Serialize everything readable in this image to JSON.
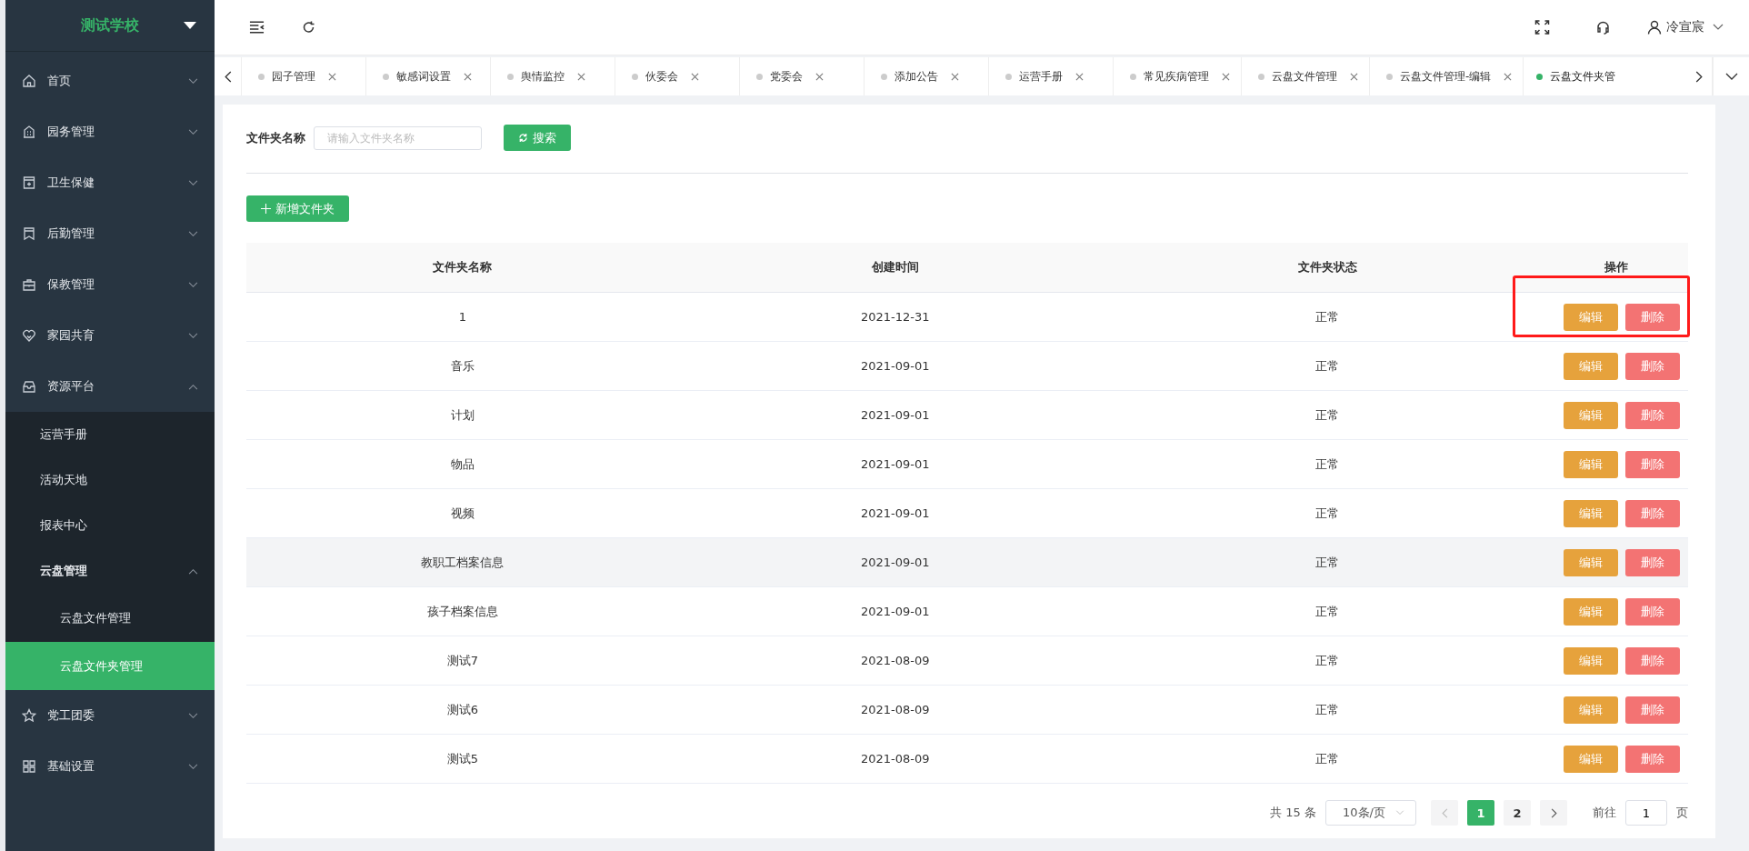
{
  "sidebar": {
    "school": "测试学校",
    "items": [
      {
        "label": "首页",
        "expanded": false
      },
      {
        "label": "园务管理",
        "expanded": false
      },
      {
        "label": "卫生保健",
        "expanded": false
      },
      {
        "label": "后勤管理",
        "expanded": false
      },
      {
        "label": "保教管理",
        "expanded": false
      },
      {
        "label": "家园共育",
        "expanded": false
      },
      {
        "label": "资源平台",
        "expanded": true,
        "children": [
          {
            "label": "运营手册",
            "selected": false
          },
          {
            "label": "活动天地",
            "selected": false
          },
          {
            "label": "报表中心",
            "selected": false
          },
          {
            "label": "云盘管理",
            "expanded": true,
            "children": [
              {
                "label": "云盘文件管理",
                "selected": false
              },
              {
                "label": "云盘文件夹管理",
                "selected": true
              }
            ]
          }
        ]
      },
      {
        "label": "党工团委",
        "expanded": false
      },
      {
        "label": "基础设置",
        "expanded": false
      }
    ]
  },
  "header": {
    "user": "冷宣宸"
  },
  "tabs": [
    {
      "label": "园子管理",
      "selected": false,
      "closable": true
    },
    {
      "label": "敏感词设置",
      "selected": false,
      "closable": true
    },
    {
      "label": "舆情监控",
      "selected": false,
      "closable": true
    },
    {
      "label": "伙委会",
      "selected": false,
      "closable": true
    },
    {
      "label": "党委会",
      "selected": false,
      "closable": true
    },
    {
      "label": "添加公告",
      "selected": false,
      "closable": true
    },
    {
      "label": "运营手册",
      "selected": false,
      "closable": true
    },
    {
      "label": "常见疾病管理",
      "selected": false,
      "closable": true
    },
    {
      "label": "云盘文件管理",
      "selected": false,
      "closable": true
    },
    {
      "label": "云盘文件管理-编辑",
      "selected": false,
      "closable": true
    },
    {
      "label": "云盘文件夹管",
      "selected": true,
      "closable": false
    }
  ],
  "search": {
    "label": "文件夹名称",
    "placeholder": "请输入文件夹名称",
    "button": "搜索"
  },
  "add_button": "新增文件夹",
  "table": {
    "columns": [
      "文件夹名称",
      "创建时间",
      "文件夹状态",
      "操作"
    ],
    "rows": [
      {
        "name": "1",
        "created": "2021-12-31",
        "status": "正常",
        "edit": "编辑",
        "delete": "删除",
        "highlighted": true,
        "hovered": false
      },
      {
        "name": "音乐",
        "created": "2021-09-01",
        "status": "正常",
        "edit": "编辑",
        "delete": "删除",
        "highlighted": false,
        "hovered": false
      },
      {
        "name": "计划",
        "created": "2021-09-01",
        "status": "正常",
        "edit": "编辑",
        "delete": "删除",
        "highlighted": false,
        "hovered": false
      },
      {
        "name": "物品",
        "created": "2021-09-01",
        "status": "正常",
        "edit": "编辑",
        "delete": "删除",
        "highlighted": false,
        "hovered": false
      },
      {
        "name": "视频",
        "created": "2021-09-01",
        "status": "正常",
        "edit": "编辑",
        "delete": "删除",
        "highlighted": false,
        "hovered": false
      },
      {
        "name": "教职工档案信息",
        "created": "2021-09-01",
        "status": "正常",
        "edit": "编辑",
        "delete": "删除",
        "highlighted": false,
        "hovered": true
      },
      {
        "name": "孩子档案信息",
        "created": "2021-09-01",
        "status": "正常",
        "edit": "编辑",
        "delete": "删除",
        "highlighted": false,
        "hovered": false
      },
      {
        "name": "测试7",
        "created": "2021-08-09",
        "status": "正常",
        "edit": "编辑",
        "delete": "删除",
        "highlighted": false,
        "hovered": false
      },
      {
        "name": "测试6",
        "created": "2021-08-09",
        "status": "正常",
        "edit": "编辑",
        "delete": "删除",
        "highlighted": false,
        "hovered": false
      },
      {
        "name": "测试5",
        "created": "2021-08-09",
        "status": "正常",
        "edit": "编辑",
        "delete": "删除",
        "highlighted": false,
        "hovered": false
      }
    ]
  },
  "pagination": {
    "total": "共 15 条",
    "page_size": "10条/页",
    "pages": [
      {
        "label": "1",
        "selected": true
      },
      {
        "label": "2",
        "selected": false
      }
    ],
    "goto_label": "前往",
    "goto_value": "1",
    "goto_suffix": "页"
  }
}
